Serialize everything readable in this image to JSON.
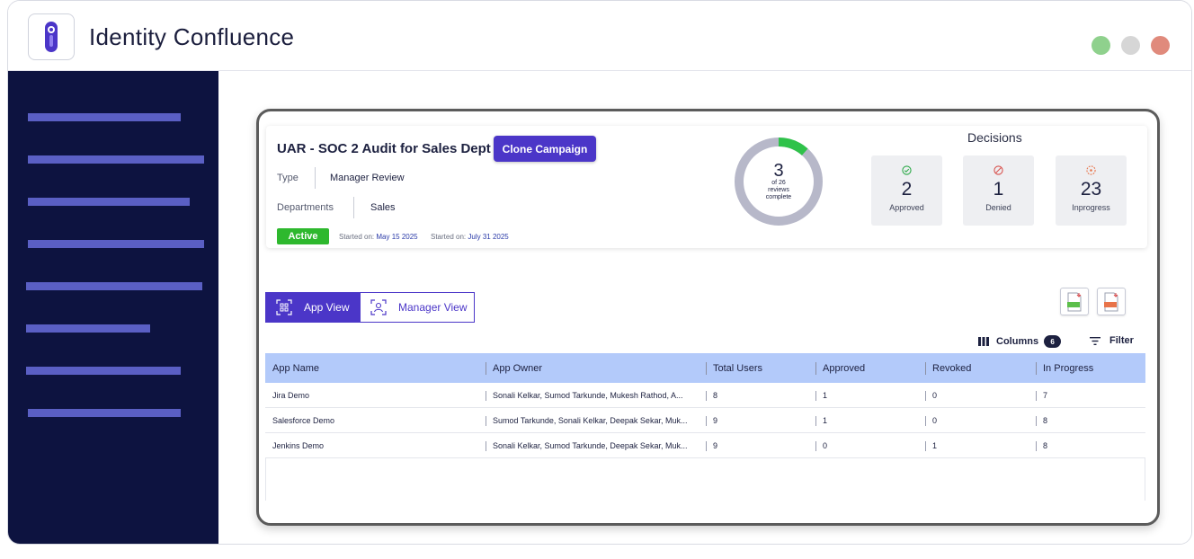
{
  "app": {
    "title": "Identity Confluence"
  },
  "window_controls": {
    "green": "#8fd18d",
    "gray": "#d6d6d6",
    "red": "#e08a7c"
  },
  "colors": {
    "sidebar": "#0d1340",
    "accent": "#4b36c8",
    "active": "#2eb82e",
    "header": "#b3cafa"
  },
  "campaign": {
    "title": "UAR - SOC 2 Audit for Sales Dept",
    "clone_label": "Clone Campaign",
    "type_label": "Type",
    "type_value": "Manager Review",
    "departments_label": "Departments",
    "departments_value": "Sales",
    "status": "Active",
    "started_label_1": "Started on:",
    "started_date_1": "May 15 2025",
    "started_label_2": "Started on:",
    "started_date_2": "July 31 2025"
  },
  "progress": {
    "completed": "3",
    "line1": "of 26",
    "line2": "reviews",
    "line3": "complete",
    "fraction": 0.1154
  },
  "decisions": {
    "title": "Decisions",
    "approved": {
      "count": "2",
      "label": "Approved",
      "icon": "check-circle-icon"
    },
    "denied": {
      "count": "1",
      "label": "Denied",
      "icon": "block-circle-icon"
    },
    "inprogress": {
      "count": "23",
      "label": "Inprogress",
      "icon": "progress-icon"
    }
  },
  "views": {
    "app_view": "App View",
    "manager_view": "Manager View"
  },
  "export": {
    "xls_icon": "xls-file-icon",
    "pdf_icon": "pdf-file-icon"
  },
  "toolbar": {
    "columns_label": "Columns",
    "columns_count": "6",
    "filter_label": "Filter"
  },
  "table": {
    "headers": [
      "App Name",
      "App Owner",
      "Total Users",
      "Approved",
      "Revoked",
      "In Progress"
    ],
    "rows": [
      [
        "Jira Demo",
        "Sonali Kelkar, Sumod Tarkunde, Mukesh Rathod, A...",
        "8",
        "1",
        "0",
        "7"
      ],
      [
        "Salesforce Demo",
        "Sumod Tarkunde, Sonali Kelkar, Deepak Sekar, Muk...",
        "9",
        "1",
        "0",
        "8"
      ],
      [
        "Jenkins Demo",
        "Sonali Kelkar, Sumod Tarkunde, Deepak Sekar, Muk...",
        "9",
        "0",
        "1",
        "8"
      ]
    ]
  }
}
